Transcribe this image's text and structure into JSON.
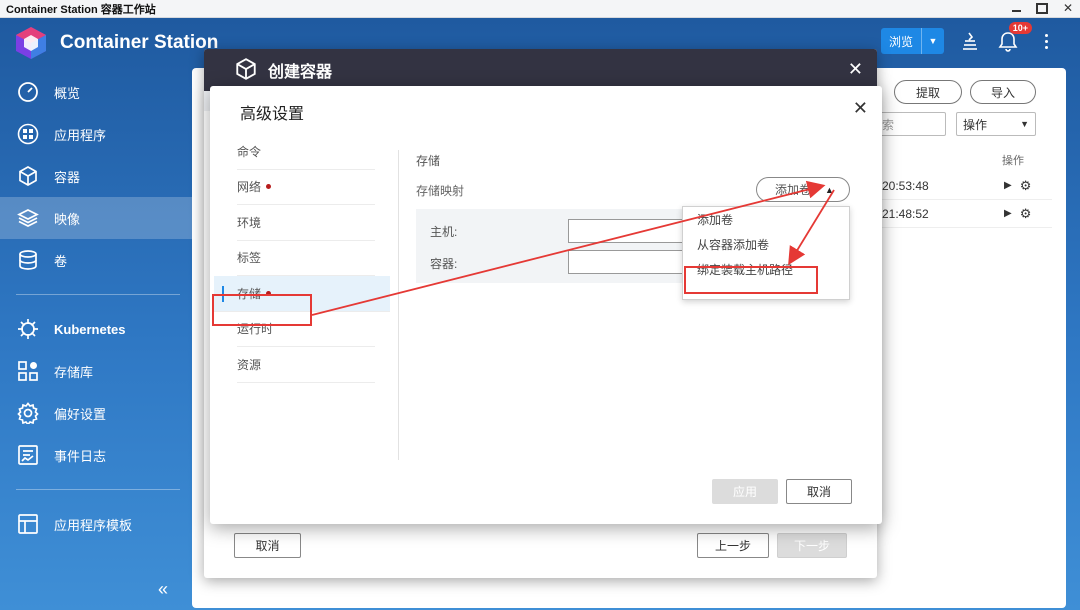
{
  "window": {
    "title": "Container Station 容器工作站"
  },
  "app": {
    "name": "Container Station",
    "browse_label": "浏览",
    "notification_badge": "10+"
  },
  "sidebar": {
    "items": [
      {
        "label": "概览",
        "icon": "speedometer-icon"
      },
      {
        "label": "应用程序",
        "icon": "apps-grid-icon"
      },
      {
        "label": "容器",
        "icon": "cube-icon"
      },
      {
        "label": "映像",
        "icon": "layers-icon",
        "active": true
      },
      {
        "label": "卷",
        "icon": "database-icon"
      }
    ],
    "group2": [
      {
        "label": "Kubernetes",
        "icon": "helm-wheel-icon"
      },
      {
        "label": "存储库",
        "icon": "repository-icon"
      },
      {
        "label": "偏好设置",
        "icon": "gear-icon"
      },
      {
        "label": "事件日志",
        "icon": "event-log-icon"
      }
    ],
    "group3": [
      {
        "label": "应用程序模板",
        "icon": "template-icon"
      }
    ],
    "collapse_icon": "double-chevron-left-icon"
  },
  "main": {
    "pull_label": "提取",
    "import_label": "导入",
    "search_placeholder": "索",
    "ops_label": "操作",
    "col_ops": "操作",
    "rows": [
      {
        "time": "20:53:48"
      },
      {
        "time": "21:48:52"
      }
    ]
  },
  "create_dialog": {
    "title": "创建容器",
    "cancel_label": "取消",
    "prev_label": "上一步",
    "next_label": "下一步"
  },
  "advanced": {
    "title": "高级设置",
    "nav": [
      {
        "label": "命令",
        "dot": false
      },
      {
        "label": "网络",
        "dot": true
      },
      {
        "label": "环境",
        "dot": false
      },
      {
        "label": "标签",
        "dot": false
      },
      {
        "label": "存储",
        "dot": true,
        "active": true
      },
      {
        "label": "运行时",
        "dot": false
      },
      {
        "label": "资源",
        "dot": false
      }
    ],
    "section_title": "存储",
    "mapping_label": "存储映射",
    "add_volume_label": "添加卷",
    "host_label": "主机:",
    "container_label": "容器:",
    "apply_label": "应用",
    "cancel_label": "取消",
    "dropdown": [
      "添加卷",
      "从容器添加卷",
      "绑定装载主机路径"
    ]
  },
  "colors": {
    "accent": "#1e88e5",
    "annotation": "#e53935",
    "dialog_header": "#333342",
    "sidebar_bg": "#2f78c4"
  }
}
